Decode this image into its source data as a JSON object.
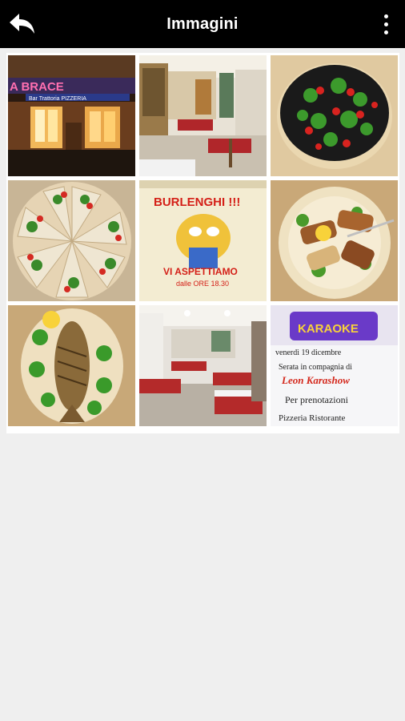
{
  "header": {
    "title": "Immagini",
    "back_icon": "back-arrow-icon",
    "menu_icon": "more-vertical-icon"
  },
  "gallery": {
    "images": [
      {
        "name": "restaurant-exterior",
        "sign_text": "A BRACE",
        "sub_text": "Bar Trattoria PIZZERIA"
      },
      {
        "name": "dining-room-bar"
      },
      {
        "name": "black-pizza-rucola-tomato"
      },
      {
        "name": "sliced-pizza-wheel"
      },
      {
        "name": "burlenghi-poster",
        "headline": "BURLENGHI !!!",
        "line1": "VI ASPETTIAMO",
        "line2": "dalle ORE 18.30"
      },
      {
        "name": "grilled-meat-plate"
      },
      {
        "name": "grilled-fish-plate"
      },
      {
        "name": "dining-room-tables"
      },
      {
        "name": "karaoke-poster",
        "logo": "KARAOKE",
        "line1": "venerdì 19 dicembre",
        "line2": "Serata in compagnia di",
        "line3": "Leon Karashow",
        "line4": "Per prenotazioni",
        "line5": "Pizzeria Ristorante"
      }
    ]
  }
}
